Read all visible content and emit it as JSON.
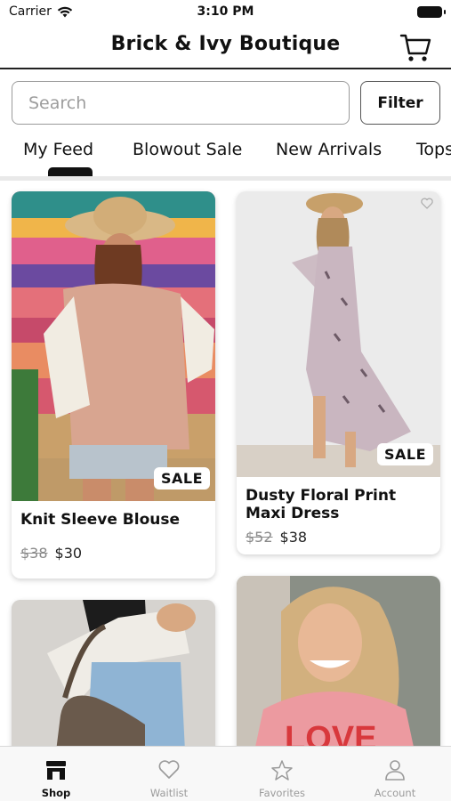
{
  "status_bar": {
    "carrier": "Carrier",
    "time": "3:10 PM"
  },
  "header": {
    "title": "Brick & Ivy Boutique",
    "cart_icon": "shopping-cart-icon"
  },
  "search": {
    "placeholder": "Search"
  },
  "filter_label": "Filter",
  "tabs": [
    {
      "label": "My Feed",
      "active": true
    },
    {
      "label": "Blowout Sale",
      "active": false
    },
    {
      "label": "New Arrivals",
      "active": false
    },
    {
      "label": "Tops",
      "active": false
    }
  ],
  "products": [
    {
      "name": "Knit Sleeve Blouse",
      "old_price": "$38",
      "price": "$30",
      "badge": "SALE"
    },
    {
      "name": "Dusty Floral Print Maxi Dress",
      "old_price": "$52",
      "price": "$38",
      "badge": "SALE",
      "favorite_icon": "heart-outline-icon"
    },
    {
      "name": "",
      "old_price": "",
      "price": ""
    },
    {
      "name": "",
      "old_price": "",
      "price": ""
    }
  ],
  "tabbar": [
    {
      "label": "Shop",
      "icon": "store-icon",
      "active": true
    },
    {
      "label": "Waitlist",
      "icon": "heart-icon",
      "active": false
    },
    {
      "label": "Favorites",
      "icon": "star-icon",
      "active": false
    },
    {
      "label": "Account",
      "icon": "person-icon",
      "active": false
    }
  ]
}
